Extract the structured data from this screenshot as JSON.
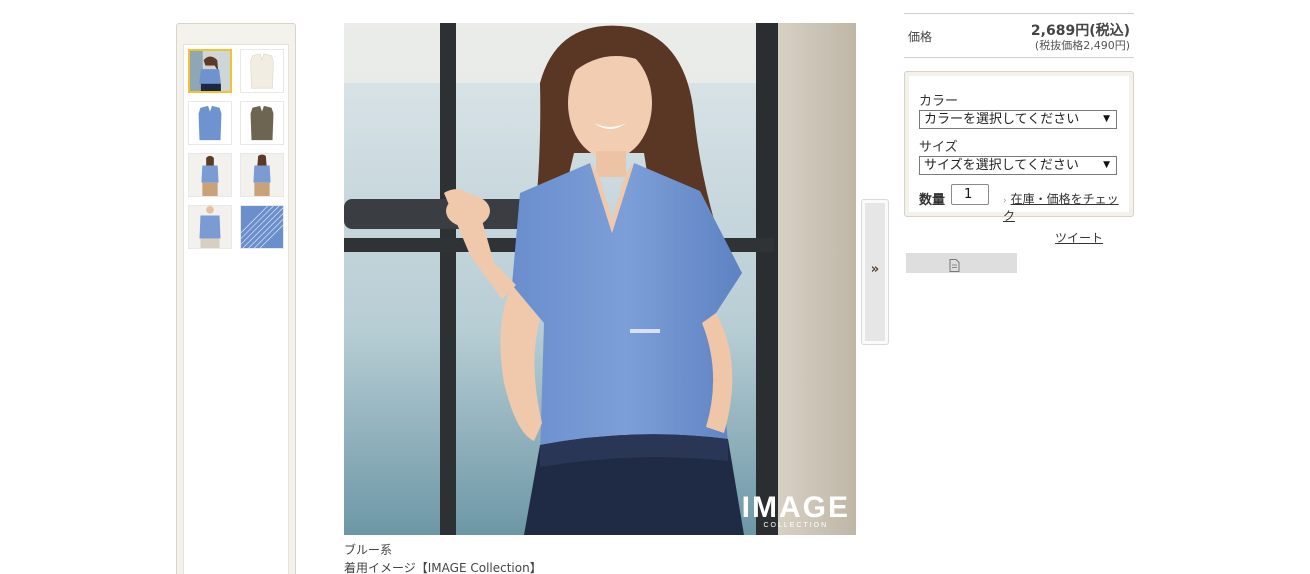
{
  "thumbnails": [
    {
      "name": "thumb-model-front",
      "selected": true
    },
    {
      "name": "thumb-white-item",
      "selected": false
    },
    {
      "name": "thumb-blue-item",
      "selected": false
    },
    {
      "name": "thumb-khaki-item",
      "selected": false
    },
    {
      "name": "thumb-model-side",
      "selected": false
    },
    {
      "name": "thumb-model-back",
      "selected": false
    },
    {
      "name": "thumb-model-half",
      "selected": false
    },
    {
      "name": "thumb-fabric-detail",
      "selected": false
    }
  ],
  "main_image": {
    "logo_text": "IMAGE",
    "logo_sub": "COLLECTION"
  },
  "caption": {
    "color_name": "ブルー系",
    "description": "着用イメージ【IMAGE Collection】"
  },
  "next_button": {
    "label": "»"
  },
  "price": {
    "label": "価格",
    "tax_included": "2,689円(税込)",
    "tax_excluded": "(税抜価格2,490円)"
  },
  "options": {
    "color_label": "カラー",
    "color_select": "カラーを選択してください",
    "size_label": "サイズ",
    "size_select": "サイズを選択してください",
    "qty_label": "数量",
    "qty_value": "1",
    "stock_link": "在庫・価格をチェック"
  },
  "share": {
    "tweet": "ツイート"
  },
  "colors": {
    "selected_border": "#f2c230",
    "blouse_blue": "#6f93cf",
    "khaki": "#6e6452"
  }
}
